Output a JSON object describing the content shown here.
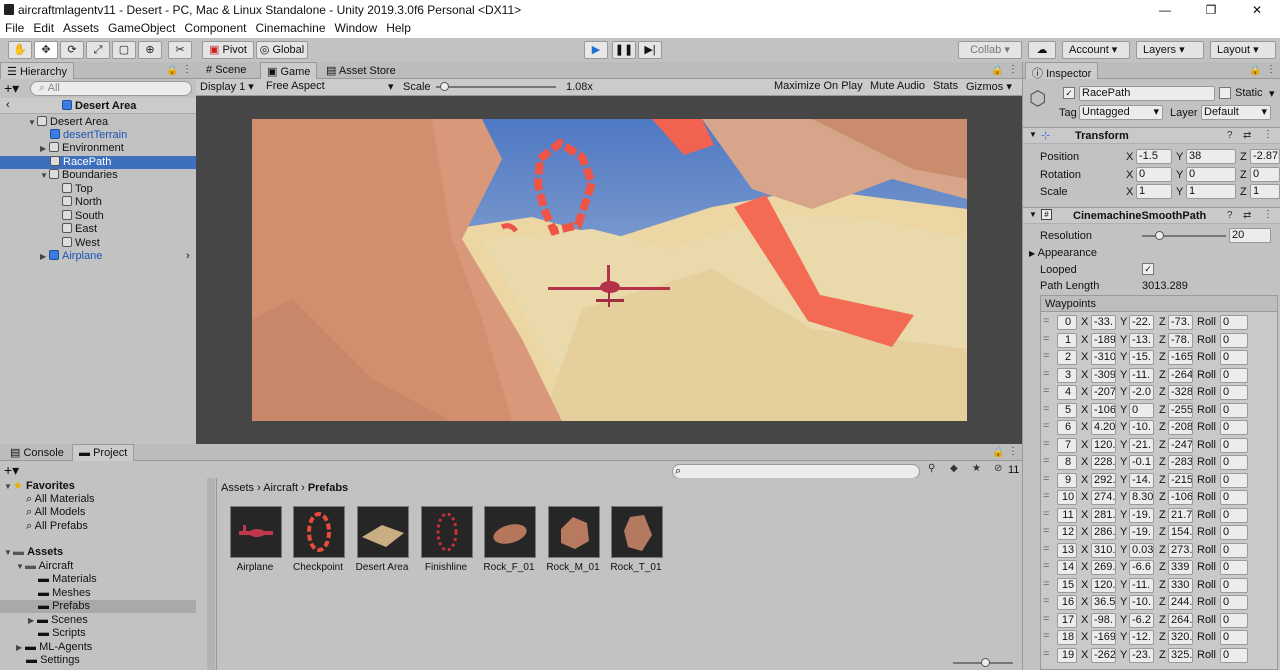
{
  "window": {
    "title": "aircraftmlagentv11 - Desert - PC, Mac & Linux Standalone - Unity 2019.3.0f6 Personal <DX11>"
  },
  "menu": [
    "File",
    "Edit",
    "Assets",
    "GameObject",
    "Component",
    "Cinemachine",
    "Window",
    "Help"
  ],
  "toolbar": {
    "pivot": "Pivot",
    "global": "Global",
    "collab": "Collab",
    "account": "Account",
    "layers": "Layers",
    "layout": "Layout"
  },
  "hierarchy": {
    "tab": "Hierarchy",
    "search_placeholder": "All",
    "scene": "Desert Area",
    "items": [
      {
        "label": "Desert Area"
      },
      {
        "label": "desertTerrain"
      },
      {
        "label": "Environment"
      },
      {
        "label": "RacePath"
      },
      {
        "label": "Boundaries"
      },
      {
        "label": "Top"
      },
      {
        "label": "North"
      },
      {
        "label": "South"
      },
      {
        "label": "East"
      },
      {
        "label": "West"
      },
      {
        "label": "Airplane"
      }
    ]
  },
  "game": {
    "tabs": [
      "Scene",
      "Game",
      "Asset Store"
    ],
    "display": "Display 1",
    "aspect": "Free Aspect",
    "scale_label": "Scale",
    "scale_value": "1.08x",
    "maximize": "Maximize On Play",
    "mute": "Mute Audio",
    "stats": "Stats",
    "gizmos": "Gizmos"
  },
  "bottom": {
    "tabs": [
      "Console",
      "Project"
    ],
    "breadcrumb": [
      "Assets",
      "Aircraft",
      "Prefabs"
    ],
    "count": "11",
    "tree": [
      {
        "label": "Favorites"
      },
      {
        "label": "All Materials"
      },
      {
        "label": "All Models"
      },
      {
        "label": "All Prefabs"
      },
      {
        "label": "Assets"
      },
      {
        "label": "Aircraft"
      },
      {
        "label": "Materials"
      },
      {
        "label": "Meshes"
      },
      {
        "label": "Prefabs"
      },
      {
        "label": "Scenes"
      },
      {
        "label": "Scripts"
      },
      {
        "label": "ML-Agents"
      },
      {
        "label": "Settings"
      }
    ],
    "prefabs": [
      "Airplane",
      "Checkpoint",
      "Desert Area",
      "Finishline",
      "Rock_F_01",
      "Rock_M_01",
      "Rock_T_01"
    ]
  },
  "inspector": {
    "tab": "Inspector",
    "name": "RacePath",
    "static": "Static",
    "tag_label": "Tag",
    "tag": "Untagged",
    "layer_label": "Layer",
    "layer": "Default",
    "transform": {
      "title": "Transform",
      "position_label": "Position",
      "position": [
        "-1.5",
        "38",
        "-2.875"
      ],
      "rotation_label": "Rotation",
      "rotation": [
        "0",
        "0",
        "0"
      ],
      "scale_label": "Scale",
      "scale": [
        "1",
        "1",
        "1"
      ]
    },
    "path": {
      "title": "CinemachineSmoothPath",
      "resolution_label": "Resolution",
      "resolution": "20",
      "appearance": "Appearance",
      "looped_label": "Looped",
      "length_label": "Path Length",
      "length": "3013.289",
      "waypoints_label": "Waypoints"
    },
    "waypoints": [
      {
        "i": "0",
        "x": "-33.",
        "y": "-22.",
        "z": "-73.",
        "roll": "0"
      },
      {
        "i": "1",
        "x": "-189",
        "y": "-13.",
        "z": "-78.",
        "roll": "0"
      },
      {
        "i": "2",
        "x": "-310",
        "y": "-15.",
        "z": "-165",
        "roll": "0"
      },
      {
        "i": "3",
        "x": "-309",
        "y": "-11.",
        "z": "-264",
        "roll": "0"
      },
      {
        "i": "4",
        "x": "-207",
        "y": "-2.0",
        "z": "-328",
        "roll": "0"
      },
      {
        "i": "5",
        "x": "-106",
        "y": "0",
        "z": "-255",
        "roll": "0"
      },
      {
        "i": "6",
        "x": "4.20",
        "y": "-10.",
        "z": "-208",
        "roll": "0"
      },
      {
        "i": "7",
        "x": "120.",
        "y": "-21.",
        "z": "-247",
        "roll": "0"
      },
      {
        "i": "8",
        "x": "228.",
        "y": "-0.1",
        "z": "-283",
        "roll": "0"
      },
      {
        "i": "9",
        "x": "292.",
        "y": "-14.",
        "z": "-215",
        "roll": "0"
      },
      {
        "i": "10",
        "x": "274.",
        "y": "8.30",
        "z": "-106",
        "roll": "0"
      },
      {
        "i": "11",
        "x": "281.",
        "y": "-19.",
        "z": "21.7",
        "roll": "0"
      },
      {
        "i": "12",
        "x": "286.",
        "y": "-19.",
        "z": "154.",
        "roll": "0"
      },
      {
        "i": "13",
        "x": "310.",
        "y": "0.03",
        "z": "273.",
        "roll": "0"
      },
      {
        "i": "14",
        "x": "269.",
        "y": "-6.6",
        "z": "339",
        "roll": "0"
      },
      {
        "i": "15",
        "x": "120.",
        "y": "-11.",
        "z": "330",
        "roll": "0"
      },
      {
        "i": "16",
        "x": "36.5",
        "y": "-10.",
        "z": "244.",
        "roll": "0"
      },
      {
        "i": "17",
        "x": "-98.",
        "y": "-6.2",
        "z": "264.",
        "roll": "0"
      },
      {
        "i": "18",
        "x": "-169",
        "y": "-12.",
        "z": "320.",
        "roll": "0"
      },
      {
        "i": "19",
        "x": "-262",
        "y": "-23.",
        "z": "325.",
        "roll": "0"
      }
    ],
    "axis": {
      "x": "X",
      "y": "Y",
      "z": "Z",
      "roll": "Roll"
    }
  }
}
